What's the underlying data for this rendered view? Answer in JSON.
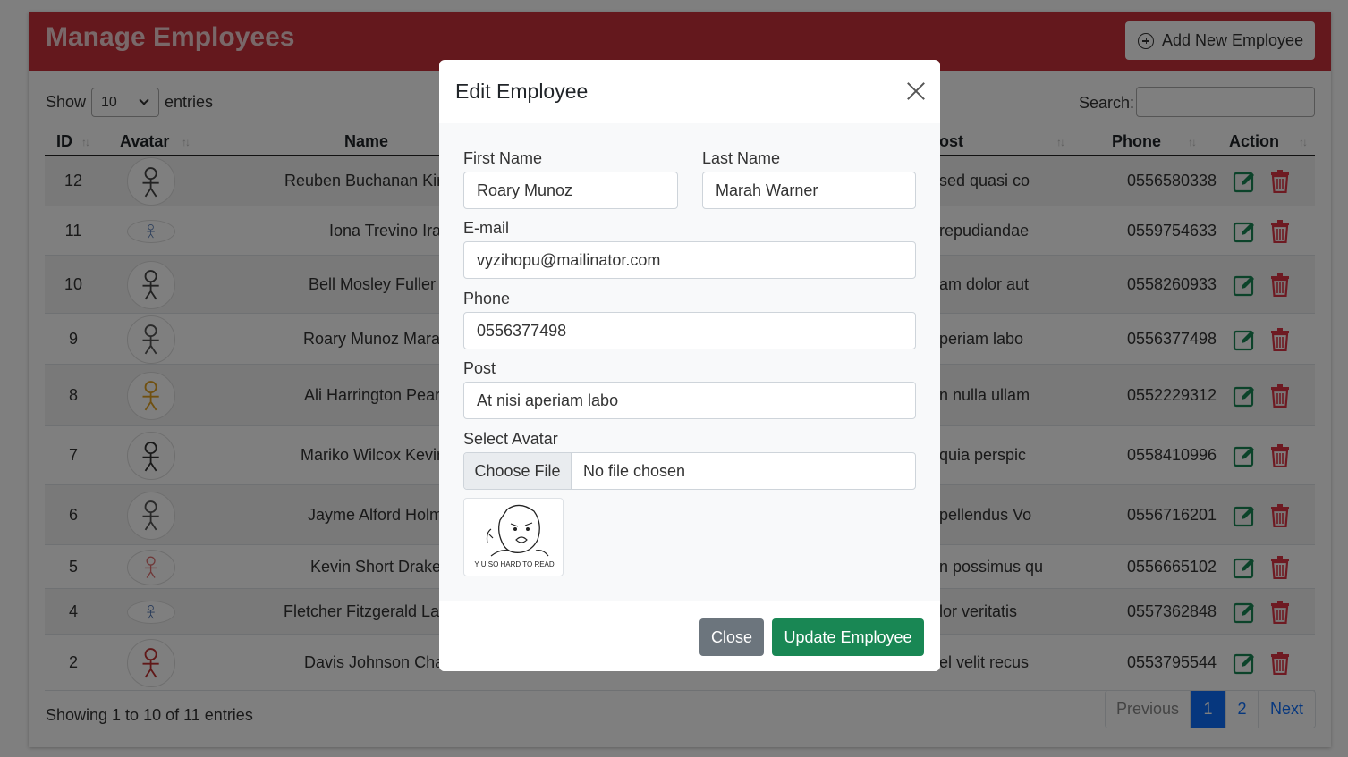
{
  "header": {
    "title": "Manage Employees",
    "add_button": "Add New Employee"
  },
  "controls": {
    "show_label": "Show",
    "page_size": "10",
    "entries_label": "entries",
    "search_label": "Search:"
  },
  "table": {
    "columns": [
      "ID",
      "Avatar",
      "Name",
      "Post",
      "Phone",
      "Action"
    ],
    "post_header_visible": "ost",
    "rows": [
      {
        "id": "12",
        "name": "Reuben Buchanan Kirsten",
        "post": "sed quasi co",
        "phone": "0556580338"
      },
      {
        "id": "11",
        "name": "Iona Trevino Ira Cra",
        "post": "repudiandae",
        "phone": "0559754633"
      },
      {
        "id": "10",
        "name": "Bell Mosley Fuller Simp",
        "post": "am dolor aut",
        "phone": "0558260933"
      },
      {
        "id": "9",
        "name": "Roary Munoz Marah W",
        "post": "periam labo",
        "phone": "0556377498"
      },
      {
        "id": "8",
        "name": "Ali Harrington Pearl Hig",
        "post": "n nulla ullam",
        "phone": "0552229312"
      },
      {
        "id": "7",
        "name": "Mariko Wilcox Kevin Gr",
        "post": "quia perspic",
        "phone": "0558410996"
      },
      {
        "id": "6",
        "name": "Jayme Alford Holmes F",
        "post": "pellendus Vo",
        "phone": "0556716201"
      },
      {
        "id": "5",
        "name": "Kevin Short Drake Mcki",
        "post": "n possimus qu",
        "phone": "0556665102"
      },
      {
        "id": "4",
        "name": "Fletcher Fitzgerald Lareina",
        "post": "lor veritatis",
        "phone": "0557362848"
      },
      {
        "id": "2",
        "name": "Davis Johnson Chanda",
        "post": "el velit recus",
        "phone": "0553795544"
      }
    ]
  },
  "footer": {
    "info": "Showing 1 to 10 of 11 entries",
    "pagination": {
      "previous": "Previous",
      "page1": "1",
      "page2": "2",
      "next": "Next",
      "current_page": 1
    }
  },
  "modal": {
    "title": "Edit Employee",
    "first_name_label": "First Name",
    "first_name_value": "Roary Munoz",
    "last_name_label": "Last Name",
    "last_name_value": "Marah Warner",
    "email_label": "E-mail",
    "email_value": "vyzihopu@mailinator.com",
    "phone_label": "Phone",
    "phone_value": "0556377498",
    "post_label": "Post",
    "post_value": "At nisi aperiam labo",
    "avatar_label": "Select Avatar",
    "file_button": "Choose File",
    "file_status": "No file chosen",
    "preview_caption": "Y U SO HARD TO READ",
    "close_button": "Close",
    "update_button": "Update Employee"
  },
  "colors": {
    "header_bg": "#c9303a",
    "edit_icon": "#198754",
    "delete_icon": "#dc3545",
    "primary": "#0d6efd",
    "update_btn": "#198754",
    "close_btn": "#6c757d"
  },
  "icons": {
    "add": "plus-circle-icon",
    "edit": "edit-icon",
    "delete": "trash-icon",
    "close": "close-icon",
    "sort": "sort-icon"
  }
}
